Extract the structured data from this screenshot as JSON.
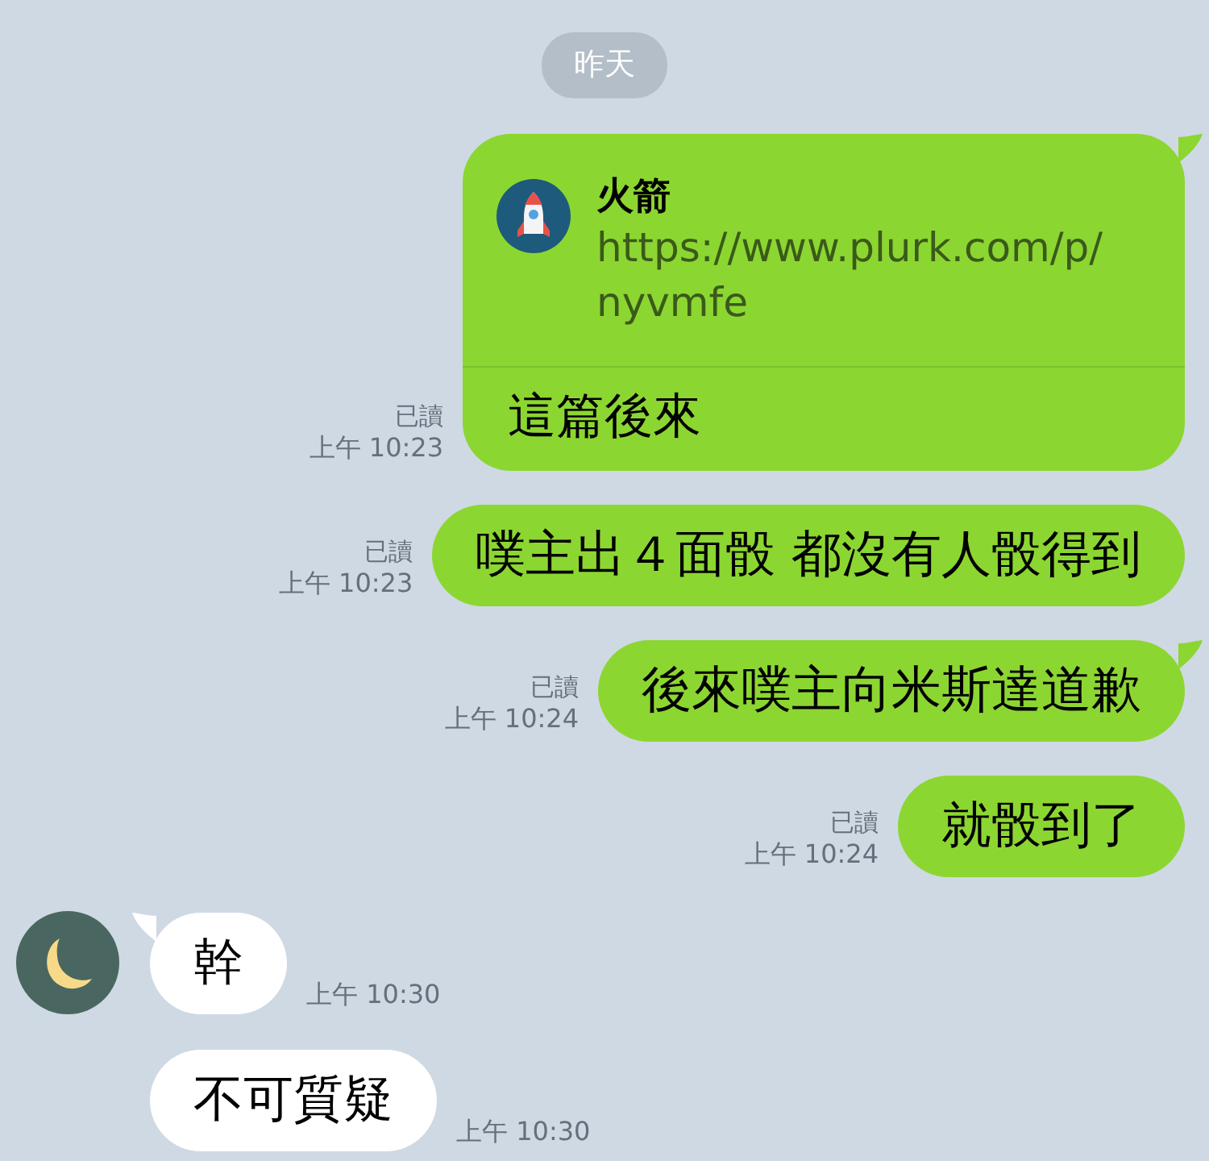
{
  "date_divider": "昨天",
  "messages": [
    {
      "kind": "sent",
      "tail": true,
      "read_label": "已讀",
      "time": "上午 10:23",
      "link": {
        "title": "火箭",
        "url_lines": [
          "https://www.plurk.com/p/",
          "nyvmfe"
        ]
      },
      "text": "這篇後來"
    },
    {
      "kind": "sent",
      "tail": false,
      "read_label": "已讀",
      "time": "上午 10:23",
      "text": "噗主出４面骰 都沒有人骰得到"
    },
    {
      "kind": "sent",
      "tail": true,
      "read_label": "已讀",
      "time": "上午 10:24",
      "text": "後來噗主向米斯達道歉"
    },
    {
      "kind": "sent",
      "tail": false,
      "read_label": "已讀",
      "time": "上午 10:24",
      "text": "就骰到了"
    },
    {
      "kind": "received",
      "tail": true,
      "avatar": true,
      "time": "上午 10:30",
      "text": "幹"
    },
    {
      "kind": "received",
      "tail": false,
      "avatar": false,
      "time": "上午 10:30",
      "text": "不可質疑"
    }
  ]
}
